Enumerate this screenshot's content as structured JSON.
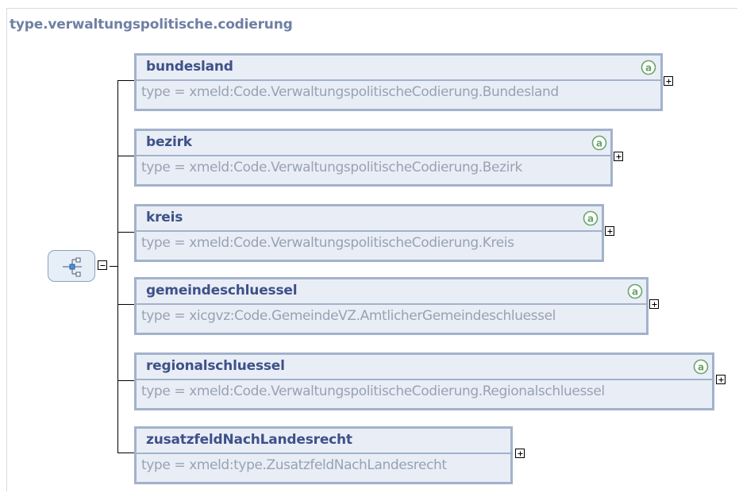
{
  "diagram": {
    "title": "type.verwaltungspolitische.codierung",
    "compositor": "sequence",
    "elements": [
      {
        "name": "bundesland",
        "type": "type = xmeld:Code.VerwaltungspolitischeCodierung.Bundesland",
        "attributes_icon": "a",
        "expand_icon": "plus-icon"
      },
      {
        "name": "bezirk",
        "type": "type = xmeld:Code.VerwaltungspolitischeCodierung.Bezirk",
        "attributes_icon": "a",
        "expand_icon": "plus-icon"
      },
      {
        "name": "kreis",
        "type": "type = xmeld:Code.VerwaltungspolitischeCodierung.Kreis",
        "attributes_icon": "a",
        "expand_icon": "plus-icon"
      },
      {
        "name": "gemeindeschluessel",
        "type": "type = xicgvz:Code.GemeindeVZ.AmtlicherGemeindeschluessel",
        "attributes_icon": "a",
        "expand_icon": "plus-icon"
      },
      {
        "name": "regionalschluessel",
        "type": "type = xmeld:Code.VerwaltungspolitischeCodierung.Regionalschluessel",
        "attributes_icon": "a",
        "expand_icon": "plus-icon"
      },
      {
        "name": "zusatzfeldNachLandesrecht",
        "type": "type = xmeld:type.ZusatzfeldNachLandesrecht",
        "expand_icon": "plus-icon"
      }
    ],
    "colors": {
      "element_border": "#a2b2cc",
      "element_fill": "#e9eef6",
      "name_text": "#3e5189",
      "type_text": "#98a2b3",
      "title_text": "#6f80a4",
      "attribute_badge": "#6aa56c"
    }
  }
}
